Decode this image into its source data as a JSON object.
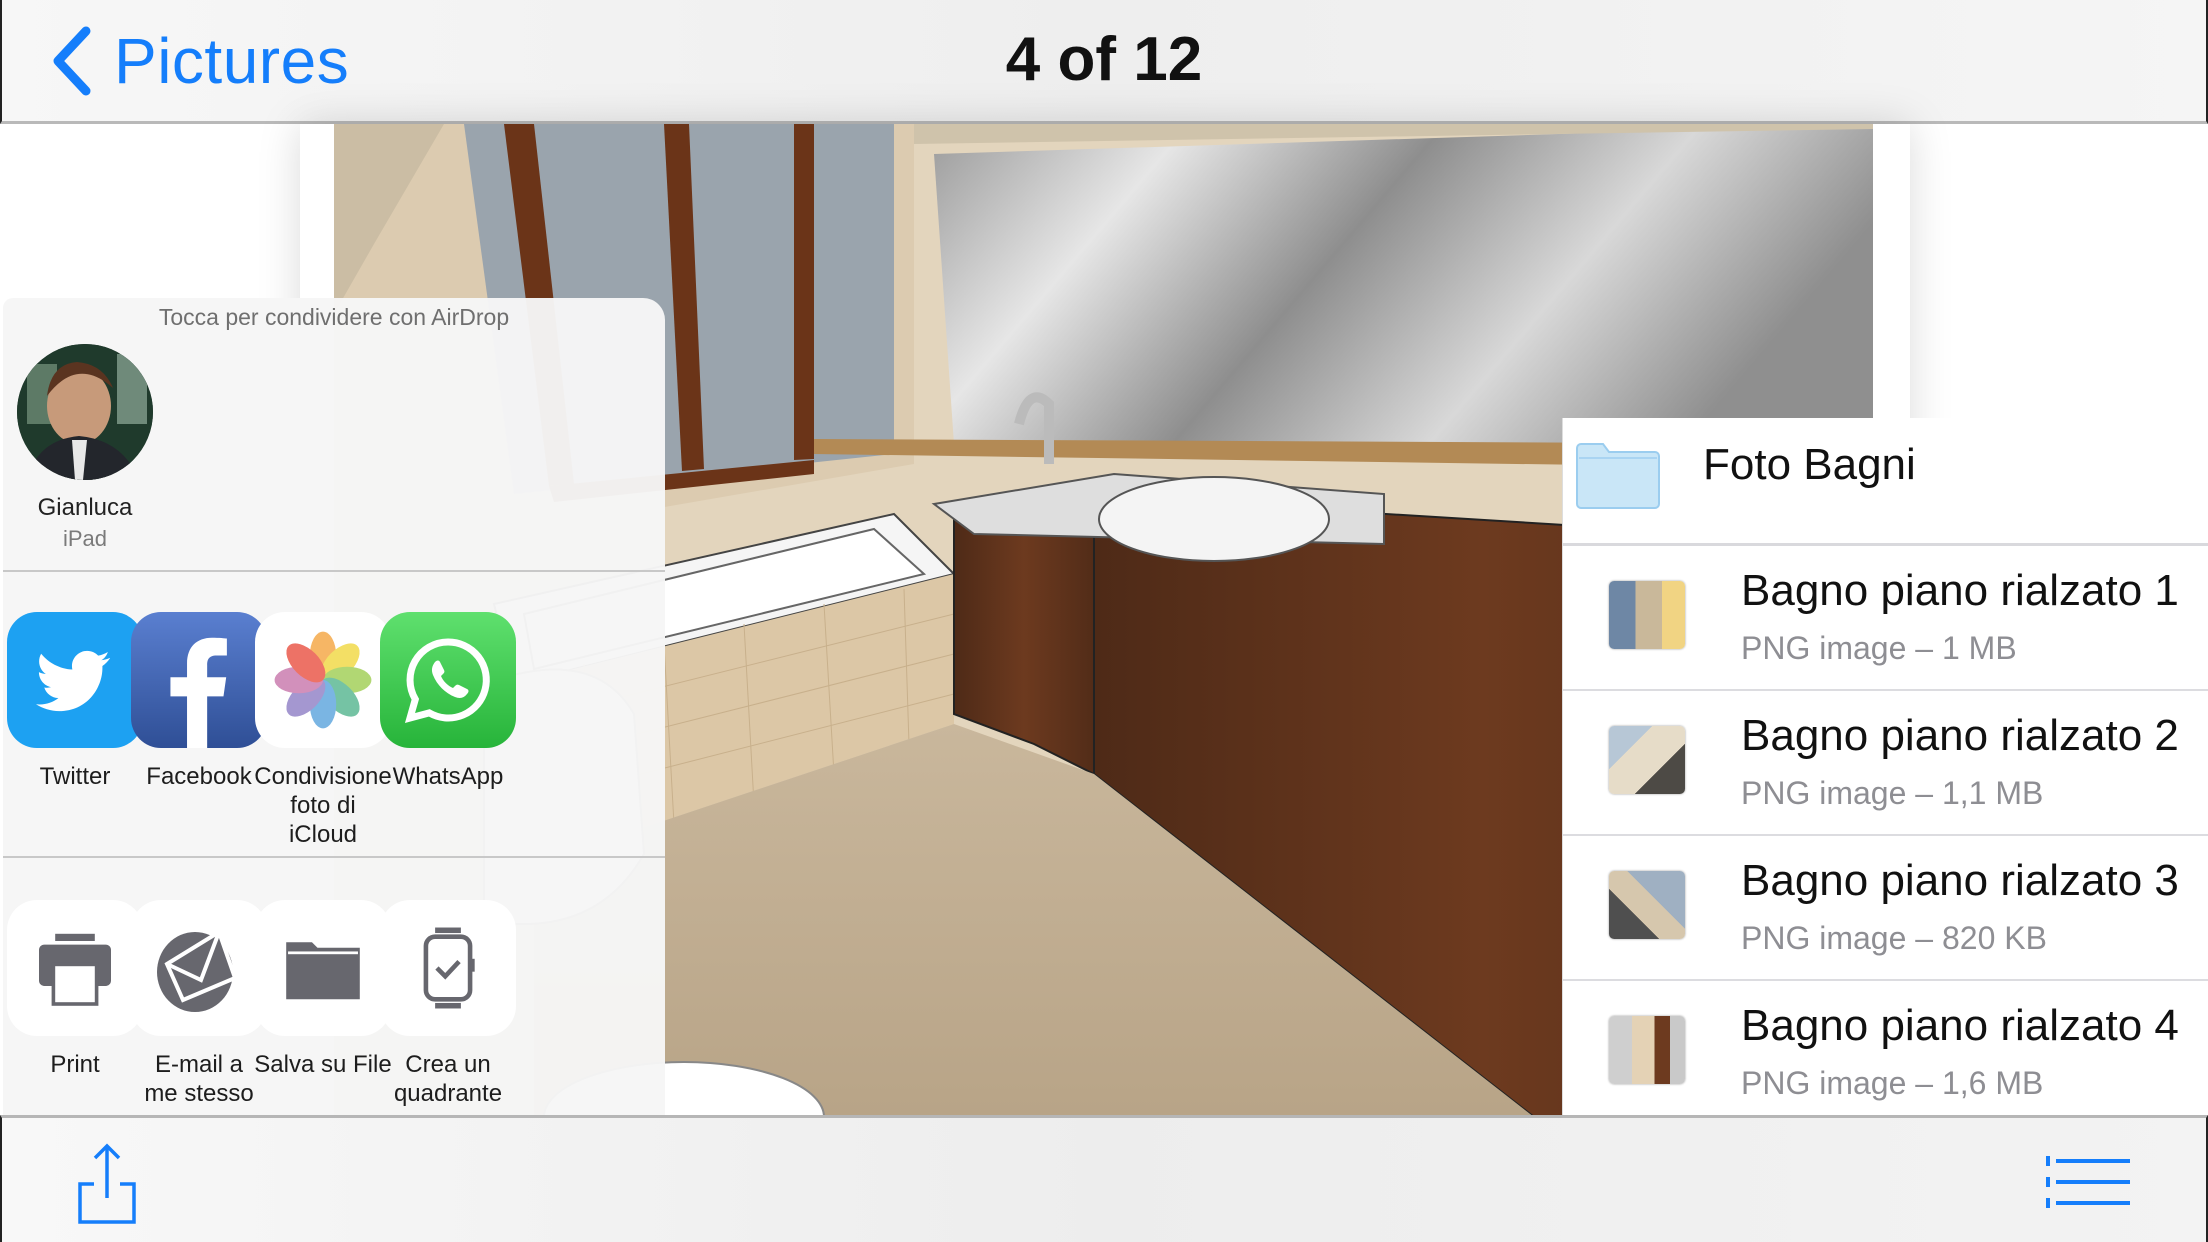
{
  "navbar": {
    "back_label": "Pictures",
    "title": "4 of 12"
  },
  "colors": {
    "accent": "#157efb",
    "secondary_text": "#8e8e93",
    "icon_gray": "#67676e"
  },
  "share_sheet": {
    "airdrop_hint": "Tocca per condividere con AirDrop",
    "airdrop_people": [
      {
        "name": "Gianluca",
        "device": "iPad"
      }
    ],
    "apps": [
      {
        "label": "Twitter",
        "icon": "twitter-icon"
      },
      {
        "label": "Facebook",
        "icon": "facebook-icon"
      },
      {
        "label": "Condivisione foto di iCloud",
        "icon": "icloud-photos-icon"
      },
      {
        "label": "WhatsApp",
        "icon": "whatsapp-icon"
      }
    ],
    "actions": [
      {
        "label": "Print",
        "icon": "printer-icon"
      },
      {
        "label": "E-mail a me stesso",
        "icon": "email-icon"
      },
      {
        "label": "Salva su File",
        "icon": "folder-icon"
      },
      {
        "label": "Crea un quadrante",
        "icon": "watch-face-icon"
      }
    ]
  },
  "files_panel": {
    "folder_name": "Foto Bagni",
    "items": [
      {
        "name": "Bagno piano rialzato 1",
        "meta": "PNG image – 1 MB"
      },
      {
        "name": "Bagno piano rialzato 2",
        "meta": "PNG image – 1,1 MB"
      },
      {
        "name": "Bagno piano rialzato 3",
        "meta": "PNG image – 820 KB"
      },
      {
        "name": "Bagno piano rialzato 4",
        "meta": "PNG image – 1,6 MB"
      }
    ]
  },
  "toolbar": {
    "share_icon": "share-icon",
    "list_icon": "list-icon"
  }
}
